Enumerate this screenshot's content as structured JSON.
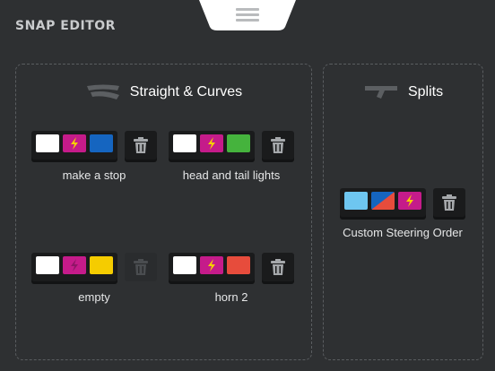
{
  "app": {
    "title": "SNAP EDITOR"
  },
  "colors": {
    "white": "#ffffff",
    "magenta": "#c51b8a",
    "blue": "#1565c0",
    "green": "#45b33d",
    "yellow": "#f5cc00",
    "red": "#e74c3c",
    "light_blue": "#6ec6f0",
    "bolt": "#f5d000"
  },
  "panels": [
    {
      "title": "Straight & Curves",
      "icon": "straight-curve-track-icon",
      "combos": [
        {
          "label": "make a stop",
          "swatches": [
            "white",
            "magenta-bolt",
            "blue"
          ],
          "trash_enabled": true
        },
        {
          "label": "head and tail lights",
          "swatches": [
            "white",
            "magenta-bolt",
            "green"
          ],
          "trash_enabled": true
        },
        {
          "label": "empty",
          "swatches": [
            "white",
            "magenta-bolt-dim",
            "yellow"
          ],
          "trash_enabled": false
        },
        {
          "label": "horn 2",
          "swatches": [
            "white",
            "magenta-bolt",
            "red"
          ],
          "trash_enabled": true
        }
      ]
    },
    {
      "title": "Splits",
      "icon": "split-track-icon",
      "combos": [
        {
          "label": "Custom Steering Order",
          "swatches": [
            "light_blue",
            "blue-red-split",
            "magenta-bolt"
          ],
          "trash_enabled": true
        }
      ]
    }
  ]
}
